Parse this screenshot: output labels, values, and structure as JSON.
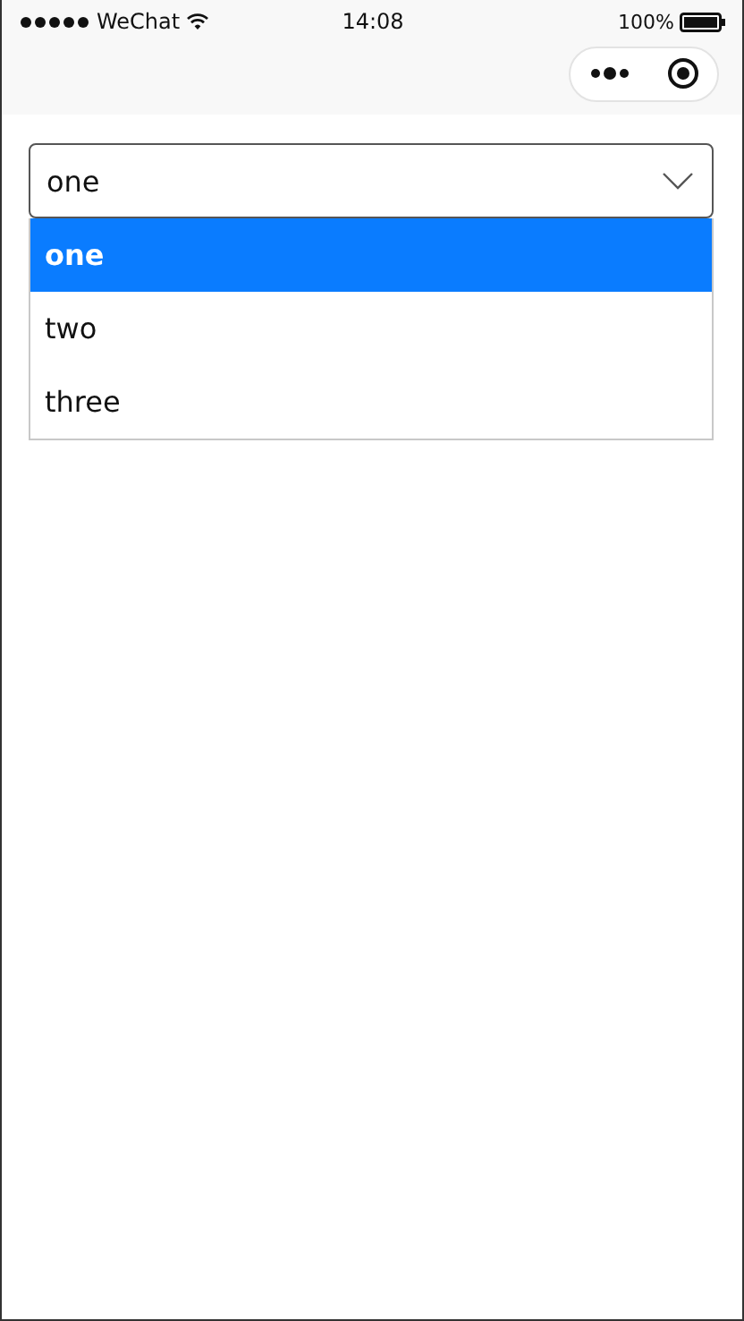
{
  "status_bar": {
    "carrier": "WeChat",
    "time": "14:08",
    "battery": "100%"
  },
  "select": {
    "value": "one",
    "expanded": true,
    "options": [
      {
        "label": "one",
        "selected": true
      },
      {
        "label": "two",
        "selected": false
      },
      {
        "label": "three",
        "selected": false
      }
    ]
  }
}
